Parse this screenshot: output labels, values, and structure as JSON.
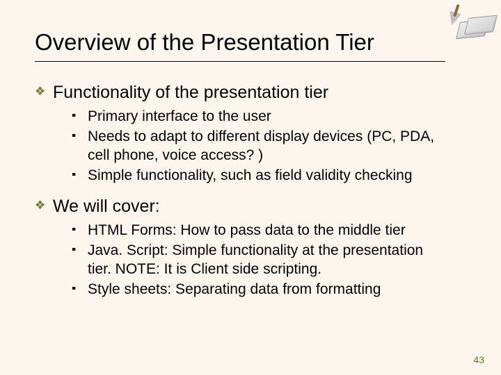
{
  "title": "Overview of the Presentation Tier",
  "sections": [
    {
      "heading": "Functionality of the presentation tier",
      "items": [
        "Primary interface to the user",
        "Needs to adapt to different display devices (PC, PDA, cell phone, voice access? )",
        "Simple functionality, such as field validity checking"
      ]
    },
    {
      "heading": "We will cover:",
      "items": [
        "HTML Forms: How to pass data to the middle tier",
        "Java. Script: Simple functionality at the presentation tier.  NOTE:  It is Client side scripting.",
        "Style sheets: Separating data from formatting"
      ]
    }
  ],
  "page_number": "43"
}
